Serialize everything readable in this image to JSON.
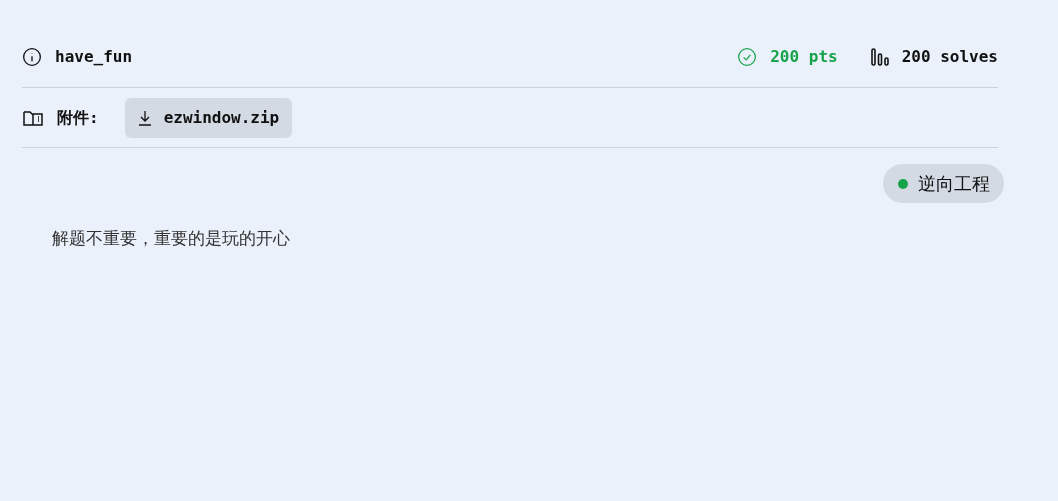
{
  "challenge": {
    "name": "have_fun",
    "points": "200 pts",
    "solves": "200 solves"
  },
  "attachments": {
    "label": "附件:",
    "files": [
      "ezwindow.zip"
    ]
  },
  "tags": [
    {
      "label": "逆向工程",
      "color": "#16a34a"
    }
  ],
  "description": "解题不重要，重要的是玩的开心"
}
